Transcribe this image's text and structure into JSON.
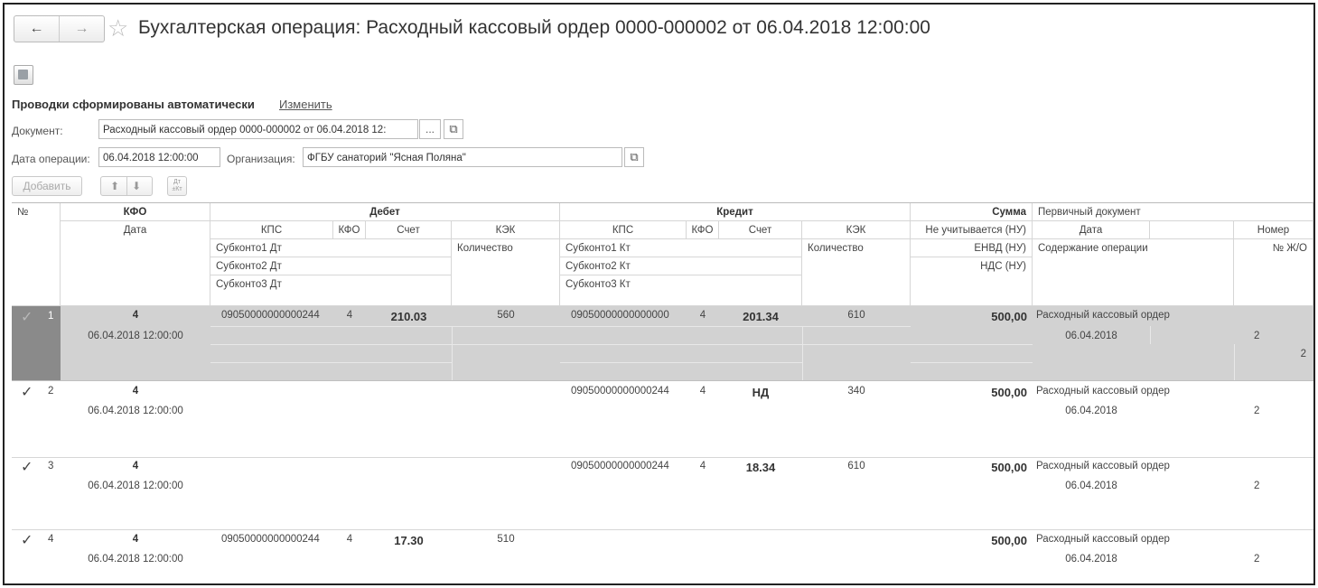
{
  "window": {
    "nav_back": "←",
    "nav_forward": "→",
    "title": "Бухгалтерская операция: Расходный кассовый ордер 0000-000002 от 06.04.2018 12:00:00"
  },
  "form": {
    "auto_label": "Проводки сформированы автоматически",
    "change_link": "Изменить",
    "document_label": "Документ:",
    "document_value": "Расходный кассовый ордер 0000-000002 от 06.04.2018 12:",
    "ellipsis": "...",
    "op_date_label": "Дата операции:",
    "op_date_value": "06.04.2018 12:00:00",
    "org_label": "Организация:",
    "org_value": "ФГБУ санаторий \"Ясная Поляна\"",
    "add_button": "Добавить",
    "dt_kt_icon": "Дт\n±Кт"
  },
  "table": {
    "headers": {
      "no": "№",
      "kfo": "КФО",
      "date": "Дата",
      "debit": "Дебет",
      "credit": "Кредит",
      "kps": "КПС",
      "kfo_small": "КФО",
      "account": "Счет",
      "kek": "КЭК",
      "qty": "Количество",
      "sub1_dt": "Субконто1 Дт",
      "sub2_dt": "Субконто2 Дт",
      "sub3_dt": "Субконто3 Дт",
      "sub1_kt": "Субконто1 Кт",
      "sub2_kt": "Субконто2 Кт",
      "sub3_kt": "Субконто3 Кт",
      "sum": "Сумма",
      "nu": "Не учитывается (НУ)",
      "envd": "ЕНВД (НУ)",
      "nds": "НДС (НУ)",
      "primary": "Первичный документ",
      "p_date": "Дата",
      "p_number": "Номер",
      "content": "Содержание операции",
      "journal": "№ Ж/О"
    },
    "rows": [
      {
        "n": "1",
        "kfo": "4",
        "date": "06.04.2018 12:00:00",
        "dt_kps": "09050000000000244",
        "dt_kfo": "4",
        "dt_acc": "210.03",
        "dt_kek": "560",
        "kt_kps": "09050000000000000",
        "kt_kfo": "4",
        "kt_acc": "201.34",
        "kt_kek": "610",
        "sum": "500,00",
        "doc": "Расходный кассовый ордер",
        "doc_date": "06.04.2018",
        "doc_num": "2",
        "journal": "2"
      },
      {
        "n": "2",
        "kfo": "4",
        "date": "06.04.2018 12:00:00",
        "dt_kps": "",
        "dt_kfo": "",
        "dt_acc": "",
        "dt_kek": "",
        "kt_kps": "09050000000000244",
        "kt_kfo": "4",
        "kt_acc": "НД",
        "kt_kek": "340",
        "sum": "500,00",
        "doc": "Расходный кассовый ордер",
        "doc_date": "06.04.2018",
        "doc_num": "2",
        "journal": ""
      },
      {
        "n": "3",
        "kfo": "4",
        "date": "06.04.2018 12:00:00",
        "dt_kps": "",
        "dt_kfo": "",
        "dt_acc": "",
        "dt_kek": "",
        "kt_kps": "09050000000000244",
        "kt_kfo": "4",
        "kt_acc": "18.34",
        "kt_kek": "610",
        "sum": "500,00",
        "doc": "Расходный кассовый ордер",
        "doc_date": "06.04.2018",
        "doc_num": "2",
        "journal": ""
      },
      {
        "n": "4",
        "kfo": "4",
        "date": "06.04.2018 12:00:00",
        "dt_kps": "09050000000000244",
        "dt_kfo": "4",
        "dt_acc": "17.30",
        "dt_kek": "510",
        "kt_kps": "",
        "kt_kfo": "",
        "kt_acc": "",
        "kt_kek": "",
        "sum": "500,00",
        "doc": "Расходный кассовый ордер",
        "doc_date": "06.04.2018",
        "doc_num": "2",
        "journal": ""
      }
    ],
    "check_mark": "✓",
    "colors": {
      "selected_row": "#d2d2d2",
      "selected_marker": "#8a8a8a",
      "grid_line": "#d6d6d6"
    }
  }
}
